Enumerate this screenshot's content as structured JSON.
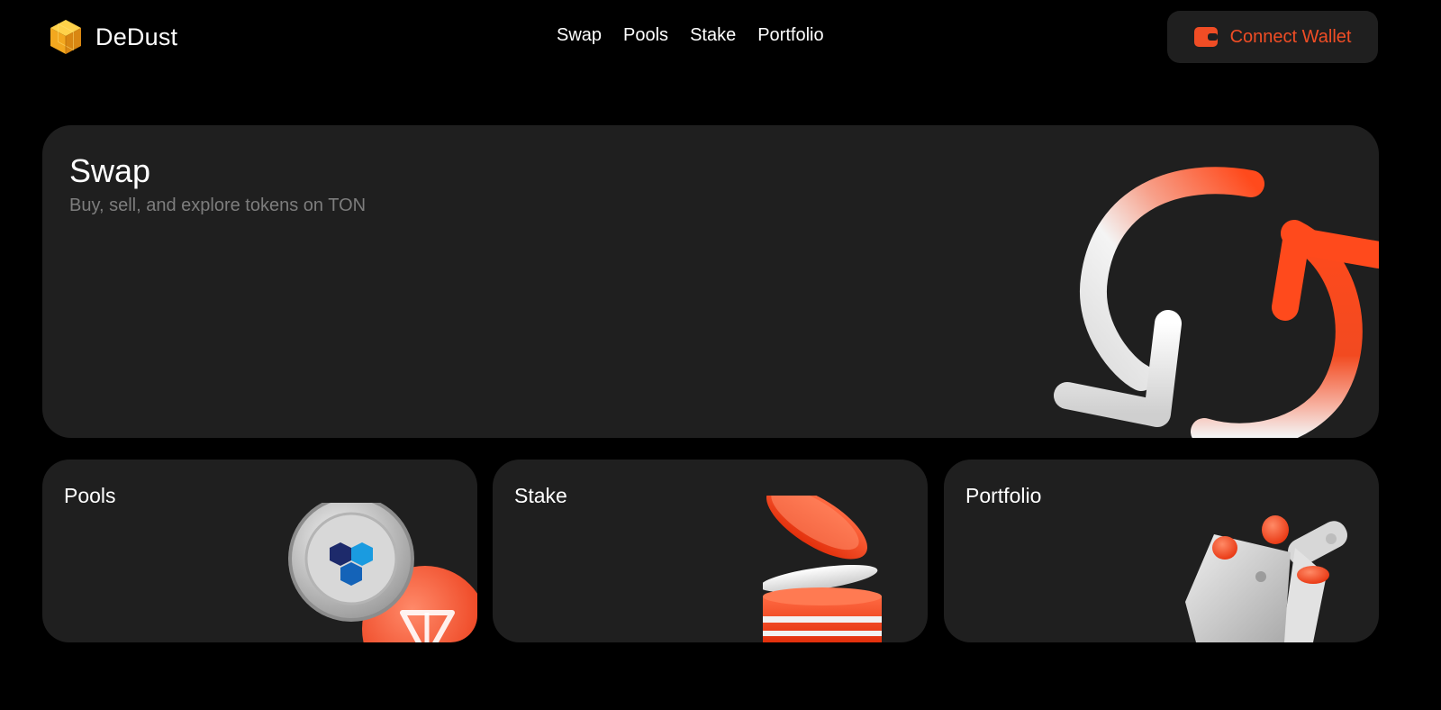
{
  "header": {
    "brand": "DeDust",
    "logo_icon": "cube-logo-icon",
    "nav": [
      {
        "label": "Swap"
      },
      {
        "label": "Pools"
      },
      {
        "label": "Stake"
      },
      {
        "label": "Portfolio"
      }
    ],
    "connect_label": "Connect Wallet",
    "connect_icon": "wallet-icon"
  },
  "cards": {
    "swap": {
      "title": "Swap",
      "subtitle": "Buy, sell, and explore tokens on TON",
      "icon": "swap-arrows-icon"
    },
    "pools": {
      "title": "Pools",
      "icon": "coins-icon"
    },
    "stake": {
      "title": "Stake",
      "icon": "coin-stack-icon"
    },
    "portfolio": {
      "title": "Portfolio",
      "icon": "wallet-illustration-icon"
    }
  },
  "colors": {
    "background": "#000000",
    "card": "#1f1f1f",
    "accent": "#f04d25",
    "muted_text": "#7d7d7d",
    "logo_gold": "#f5b82e"
  }
}
